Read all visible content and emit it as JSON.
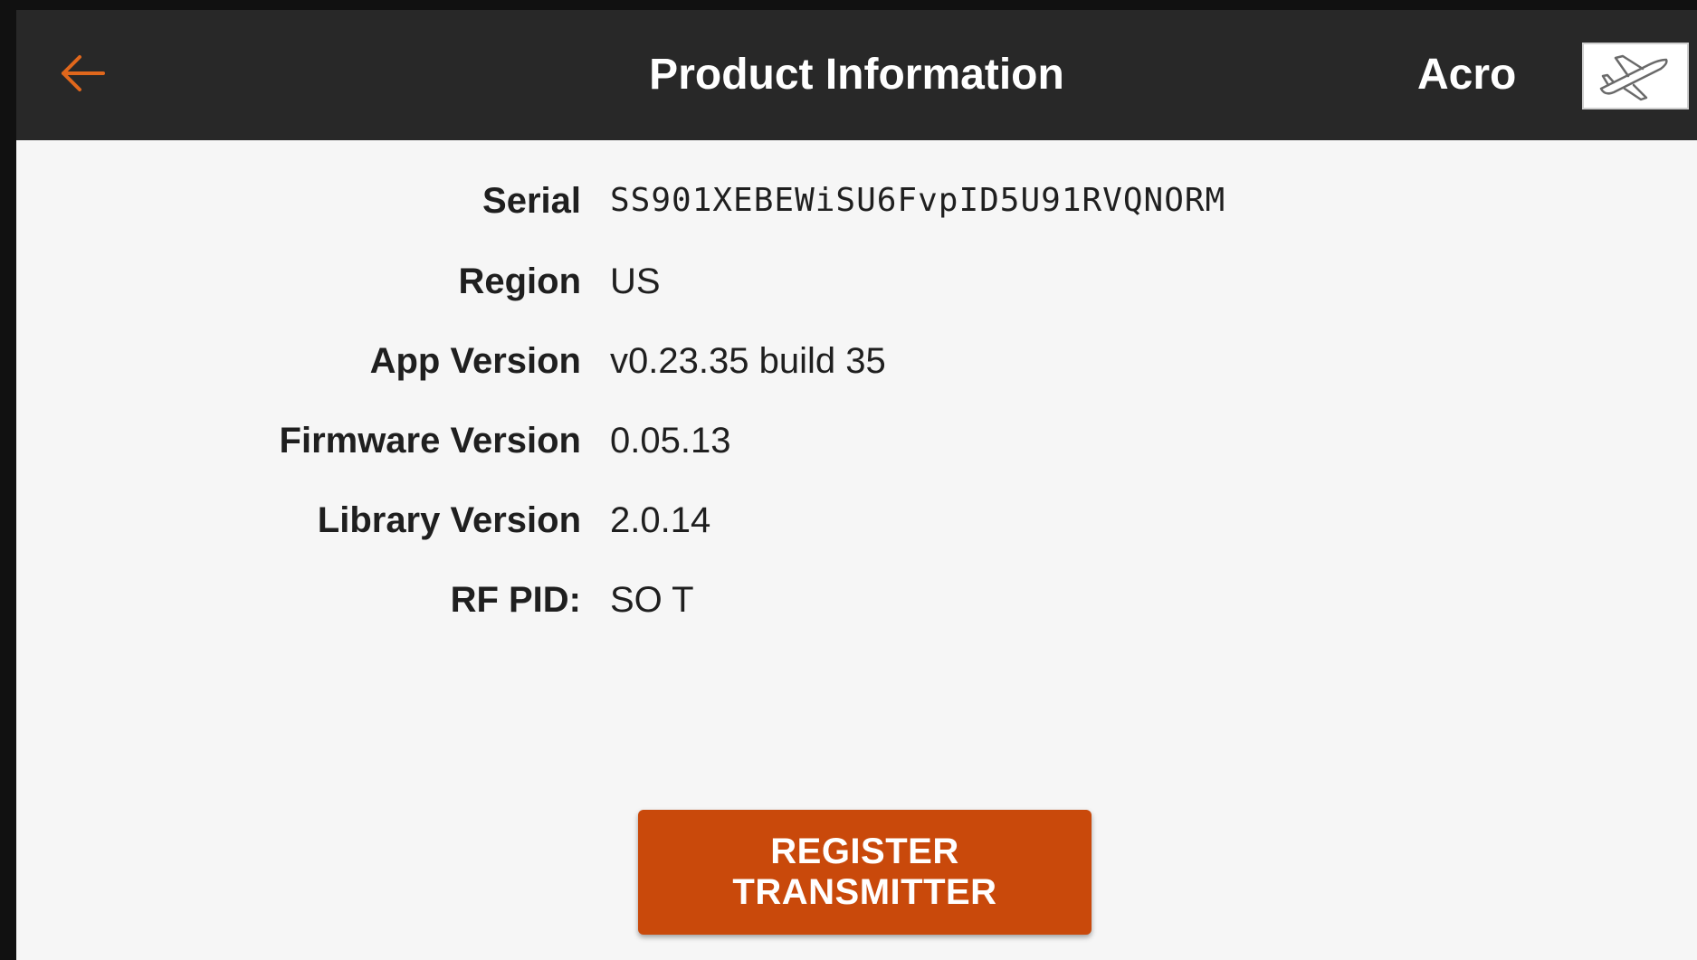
{
  "header": {
    "back_icon": "arrow-left-icon",
    "title": "Product Information",
    "model_name": "Acro",
    "model_icon": "airplane-icon",
    "accent_color": "#e0671c"
  },
  "info": [
    {
      "label": "Serial",
      "value": "SS901XEBEWiSU6FvpID5U91RVQNORM"
    },
    {
      "label": "Region",
      "value": "US"
    },
    {
      "label": "App Version",
      "value": "v0.23.35 build 35"
    },
    {
      "label": "Firmware Version",
      "value": "0.05.13"
    },
    {
      "label": "Library Version",
      "value": "2.0.14"
    },
    {
      "label": "RF PID:",
      "value": "SO T"
    }
  ],
  "actions": {
    "register_label": "REGISTER TRANSMITTER",
    "register_color": "#c9490b"
  }
}
